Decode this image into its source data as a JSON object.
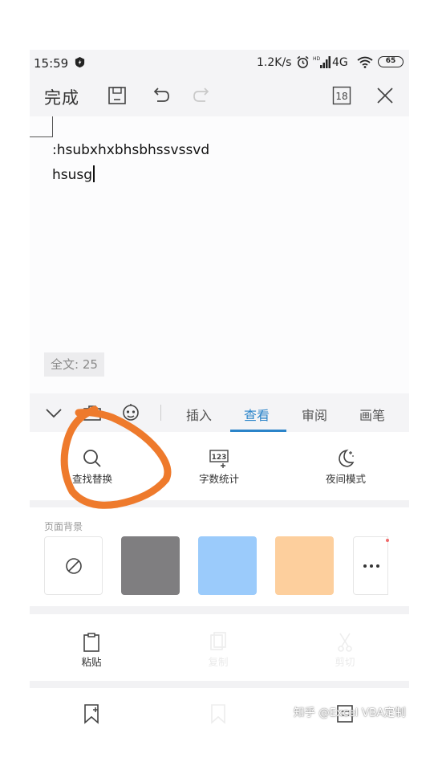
{
  "status_bar": {
    "time": "15:59",
    "net_speed": "1.2K/s",
    "network_type": "4G",
    "battery": "65",
    "icons": [
      "speed-boost-icon",
      "alarm-icon",
      "signal-icon",
      "wifi-icon",
      "battery-icon"
    ]
  },
  "toolbar": {
    "done_label": "完成",
    "page_count": "18",
    "icons": [
      "save-icon",
      "undo-icon",
      "redo-icon",
      "page-count-icon",
      "close-icon"
    ]
  },
  "document": {
    "lines": [
      ":hsubxhxbhsbhssvssvd",
      "hsusg"
    ],
    "word_count": "全文: 25"
  },
  "tab_bar": {
    "tabs": [
      {
        "label": "插入",
        "active": false
      },
      {
        "label": "查看",
        "active": true
      },
      {
        "label": "审阅",
        "active": false
      },
      {
        "label": "画笔",
        "active": false
      }
    ],
    "active_color": "#2b84c9",
    "icons": [
      "collapse-chevron-icon",
      "clipboard-edit-icon",
      "robot-face-icon"
    ]
  },
  "view_tools": [
    {
      "label": "查找替换",
      "icon": "search-icon"
    },
    {
      "label": "字数统计",
      "icon": "word-count-icon"
    },
    {
      "label": "夜间模式",
      "icon": "night-mode-icon"
    }
  ],
  "page_background": {
    "title": "页面背景",
    "swatches": [
      {
        "name": "none",
        "color": "#ffffff",
        "icon": "no-background-icon"
      },
      {
        "name": "gray",
        "color": "#7f7e80"
      },
      {
        "name": "blue",
        "color": "#9bcbfb"
      },
      {
        "name": "orange",
        "color": "#fdcf9d"
      },
      {
        "name": "more",
        "color": "#ffffff",
        "icon": "more-icon"
      }
    ]
  },
  "actions": [
    {
      "label": "粘贴",
      "icon": "paste-icon",
      "enabled": true
    },
    {
      "label": "复制",
      "icon": "copy-icon",
      "enabled": false
    },
    {
      "label": "剪切",
      "icon": "cut-icon",
      "enabled": false
    }
  ],
  "actions_row2_icons": [
    "add-bookmark-icon",
    "bookmark-icon",
    "outline-icon"
  ],
  "watermark": "知乎 @Excel VBA定制",
  "annotation_color": "#ee7a2c"
}
